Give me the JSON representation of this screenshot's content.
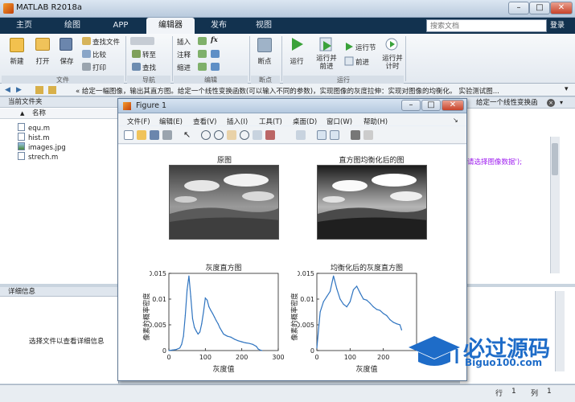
{
  "app": {
    "title": "MATLAB R2018a"
  },
  "ribbon_tabs": [
    {
      "label": "主页",
      "active": false
    },
    {
      "label": "绘图",
      "active": false
    },
    {
      "label": "APP",
      "active": false
    },
    {
      "label": "编辑器",
      "active": true
    },
    {
      "label": "发布",
      "active": false
    },
    {
      "label": "视图",
      "active": false
    }
  ],
  "search": {
    "placeholder": "搜索文档"
  },
  "login_label": "登录",
  "ribbon": {
    "new": "新建",
    "open": "打开",
    "save": "保存",
    "find_files": "查找文件",
    "compare": "比较",
    "print": "打印",
    "file_group": "文件",
    "goto": "转至",
    "find": "查找",
    "nav_group": "导航",
    "insert": "插入",
    "comment": "注释",
    "indent": "缩进",
    "fx": "fx",
    "edit_group": "编辑",
    "breakpoints": "断点",
    "bp_group": "断点",
    "run": "运行",
    "run_advance": "运行并\n前进",
    "run_section": "运行节",
    "advance": "前进",
    "run_time": "运行并\n计时",
    "run_group": "运行"
  },
  "address_bar": {
    "path": "« 给定一幅图像，输出其直方图。给定一个线性变换函数(可以输入不同的参数)，实现图像的灰度拉伸：实现对图像的均衡化。 实验测试图..."
  },
  "current_folder": {
    "title": "当前文件夹",
    "column": "名称",
    "files": [
      {
        "name": "equ.m",
        "type": "m"
      },
      {
        "name": "hist.m",
        "type": "m"
      },
      {
        "name": "images.jpg",
        "type": "img"
      },
      {
        "name": "strech.m",
        "type": "m"
      }
    ]
  },
  "details": {
    "title": "详细信息",
    "hint": "选择文件以查看详细信息"
  },
  "editor": {
    "tab": "给定一个线性变换函",
    "code": ",'请选择图像数据');"
  },
  "status": {
    "row_label": "行",
    "row": "1",
    "col_label": "列",
    "col": "1"
  },
  "figure": {
    "title": "Figure 1",
    "menu": [
      "文件(F)",
      "编辑(E)",
      "查看(V)",
      "插入(I)",
      "工具(T)",
      "桌面(D)",
      "窗口(W)",
      "帮助(H)"
    ],
    "img_titles": [
      "原图",
      "直方图均衡化后的图"
    ]
  },
  "watermark": {
    "text": "必过源码",
    "sub": "Biguo100.com"
  },
  "chart_data": [
    {
      "type": "line",
      "title": "灰度直方图",
      "xlabel": "灰度值",
      "ylabel": "像素的概率密度",
      "xlim": [
        0,
        300
      ],
      "ylim": [
        0,
        0.015
      ],
      "xticks": [
        0,
        100,
        200,
        300
      ],
      "yticks": [
        0,
        0.005,
        0.01,
        0.015
      ],
      "color": "#2f74c0",
      "x": [
        0,
        10,
        20,
        30,
        35,
        40,
        45,
        50,
        55,
        60,
        65,
        70,
        75,
        80,
        85,
        90,
        95,
        100,
        105,
        110,
        115,
        120,
        125,
        130,
        135,
        140,
        145,
        150,
        155,
        160,
        170,
        180,
        190,
        200,
        210,
        220,
        230,
        240,
        245,
        250,
        255
      ],
      "y": [
        0,
        0.0001,
        0.0002,
        0.0005,
        0.0012,
        0.0028,
        0.0068,
        0.0118,
        0.0145,
        0.0105,
        0.0062,
        0.0045,
        0.0038,
        0.0032,
        0.0036,
        0.0052,
        0.0075,
        0.0102,
        0.0098,
        0.0085,
        0.0078,
        0.0072,
        0.0065,
        0.0058,
        0.0052,
        0.0044,
        0.0038,
        0.0032,
        0.003,
        0.0028,
        0.0026,
        0.0022,
        0.0019,
        0.0017,
        0.0015,
        0.0014,
        0.0012,
        0.0008,
        0.0003,
        0.0001,
        0
      ]
    },
    {
      "type": "line",
      "title": "均衡化后的灰度直方图",
      "xlabel": "灰度值",
      "ylabel": "像素的概率密度",
      "xlim": [
        0,
        300
      ],
      "ylim": [
        0,
        0.015
      ],
      "xticks": [
        0,
        100,
        200
      ],
      "yticks": [
        0,
        0.005,
        0.01,
        0.015
      ],
      "color": "#2f74c0",
      "x": [
        0,
        10,
        20,
        30,
        40,
        50,
        60,
        70,
        80,
        90,
        100,
        110,
        120,
        130,
        140,
        150,
        160,
        170,
        180,
        190,
        200,
        210,
        220,
        230,
        240,
        250,
        255
      ],
      "y": [
        0.0005,
        0.0075,
        0.0095,
        0.0105,
        0.0115,
        0.0145,
        0.012,
        0.01,
        0.009,
        0.0085,
        0.0095,
        0.0118,
        0.0125,
        0.0112,
        0.01,
        0.0098,
        0.0092,
        0.0085,
        0.008,
        0.0078,
        0.0072,
        0.0068,
        0.006,
        0.0055,
        0.0052,
        0.005,
        0.004
      ]
    }
  ]
}
